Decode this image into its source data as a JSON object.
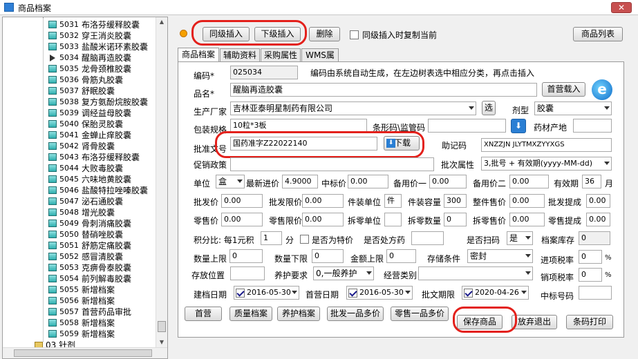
{
  "window": {
    "title": "商品档案"
  },
  "tree": {
    "items": [
      {
        "code": "5031",
        "name": "布洛芬缓释胶囊"
      },
      {
        "code": "5032",
        "name": "穿王消炎胶囊"
      },
      {
        "code": "5033",
        "name": "盐酸米诺环素胶囊"
      },
      {
        "code": "5034",
        "name": "醒脑再造胶囊"
      },
      {
        "code": "5035",
        "name": "龙骨颈椎胶囊"
      },
      {
        "code": "5036",
        "name": "骨筋丸胶囊"
      },
      {
        "code": "5037",
        "name": "舒眠胶囊"
      },
      {
        "code": "5038",
        "name": "复方氨酚烷胺胶囊"
      },
      {
        "code": "5039",
        "name": "调经益母胶囊"
      },
      {
        "code": "5040",
        "name": "保胎灵胶囊"
      },
      {
        "code": "5041",
        "name": "金蝉止痒胶囊"
      },
      {
        "code": "5042",
        "name": "肾骨胶囊"
      },
      {
        "code": "5043",
        "name": "布洛芬缓释胶囊"
      },
      {
        "code": "5044",
        "name": "大败毒胶囊"
      },
      {
        "code": "5045",
        "name": "六味地黄胶囊"
      },
      {
        "code": "5046",
        "name": "盐酸特拉唑嗪胶囊"
      },
      {
        "code": "5047",
        "name": "泌石通胶囊"
      },
      {
        "code": "5048",
        "name": "增光胶囊"
      },
      {
        "code": "5049",
        "name": "骨刺消痛胶囊"
      },
      {
        "code": "5050",
        "name": "替硝唑胶囊"
      },
      {
        "code": "5051",
        "name": "舒筋定痛胶囊"
      },
      {
        "code": "5052",
        "name": "感冒清胶囊"
      },
      {
        "code": "5053",
        "name": "克痹骨泰胶囊"
      },
      {
        "code": "5054",
        "name": "前列解毒胶囊"
      },
      {
        "code": "5055",
        "name": "新增档案"
      },
      {
        "code": "5056",
        "name": "新增档案"
      },
      {
        "code": "5057",
        "name": "首营药品审批"
      },
      {
        "code": "5058",
        "name": "新增档案"
      },
      {
        "code": "5059",
        "name": "新增档案"
      }
    ],
    "folder": "03 针剂"
  },
  "toolbar": {
    "sibling_insert": "同级插入",
    "child_insert": "下级插入",
    "delete": "删除",
    "copy_checkbox": "同级插入时复制当前",
    "product_list": "商品列表"
  },
  "tabs": [
    "商品档案",
    "辅助资料",
    "采购属性",
    "WMS属性"
  ],
  "form": {
    "code_label": "编码*",
    "code_value": "025034",
    "code_hint": "编码由系统自动生成，在左边树表选中相应分类，再点击插入",
    "name_label": "品名*",
    "name_value": "醒脑再造胶囊",
    "first_load_btn": "首营载入",
    "manufacturer_label": "生产厂家",
    "manufacturer_value": "吉林亚泰明星制药有限公司",
    "select_btn": "选",
    "dosage_label": "剂型",
    "dosage_value": "胶囊",
    "spec_label": "包装规格",
    "spec_value": "10粒*3板",
    "barcode_label": "条形码\\监管码",
    "herb_origin_label": "药材产地",
    "approval_label": "批准文号",
    "approval_value": "国药准字Z22022140",
    "download_btn": "下载",
    "mnemonic_label": "助记码",
    "mnemonic_value": "XNZZJN JLYTMXZYYXGS",
    "promo_label": "促销政策",
    "batch_attr_label": "批次属性",
    "batch_attr_value": "3,批号 + 有效期(yyyy-MM-dd)",
    "unit_label": "单位",
    "unit_value": "盒",
    "latest_price_label": "最新进价",
    "latest_price_value": "4.9000",
    "bid_price_label": "中标价",
    "bid_price_value": "0.00",
    "spare_price1_label": "备用价一",
    "spare_price1_value": "0.00",
    "spare_price2_label": "备用价二",
    "spare_price2_value": "0.00",
    "validity_label": "有效期",
    "validity_value": "36",
    "validity_unit": "月",
    "wholesale_label": "批发价",
    "wholesale_value": "0.00",
    "wholesale_limit_label": "批发限价",
    "wholesale_limit_value": "0.00",
    "piece_unit_label": "件装单位",
    "piece_unit_value": "件",
    "piece_qty_label": "件装容量",
    "piece_qty_value": "300",
    "whole_price_label": "整件售价",
    "whole_price_value": "0.00",
    "wholesale_commission_label": "批发提成",
    "wholesale_commission_value": "0.00",
    "retail_label": "零售价",
    "retail_value": "0.00",
    "retail_limit_label": "零售限价",
    "retail_limit_value": "0.00",
    "split_unit_label": "拆零单位",
    "split_qty_label": "拆零数量",
    "split_qty_value": "0",
    "split_price_label": "拆零售价",
    "split_price_value": "0.00",
    "retail_commission_label": "零售提成",
    "retail_commission_value": "0.00",
    "points_label": "积分比: 每1元积",
    "points_value": "1",
    "points_unit": "分",
    "special_price_label": "是否为特价",
    "prescription_label": "是否处方药",
    "scan_label": "是否扫码",
    "scan_value": "是",
    "archive_stock_label": "档案库存",
    "archive_stock_value": "0",
    "qty_upper_label": "数量上限",
    "qty_upper_value": "0",
    "qty_lower_label": "数量下限",
    "qty_lower_value": "0",
    "amount_upper_label": "金额上限",
    "amount_upper_value": "0",
    "storage_label": "存储条件",
    "storage_value": "密封",
    "input_tax_label": "进项税率",
    "input_tax_value": "0",
    "percent": "%",
    "location_label": "存放位置",
    "maintenance_label": "养护要求",
    "maintenance_value": "0,一般养护",
    "business_type_label": "经营类别",
    "output_tax_label": "销项税率",
    "output_tax_value": "0",
    "build_date_label": "建档日期",
    "build_date_value": "2016-05-30",
    "first_date_label": "首营日期",
    "first_date_value": "2016-05-30",
    "approval_expiry_label": "批文期限",
    "approval_expiry_value": "2020-04-26",
    "bid_code_label": "中标号码"
  },
  "bottom_buttons": {
    "first": "首营",
    "quality": "质量档案",
    "maintenance": "养护档案",
    "wholesale_multi": "批发一品多价",
    "retail_multi": "零售一品多价",
    "save": "保存商品",
    "cancel": "放弃退出",
    "barcode_print": "条码打印"
  }
}
